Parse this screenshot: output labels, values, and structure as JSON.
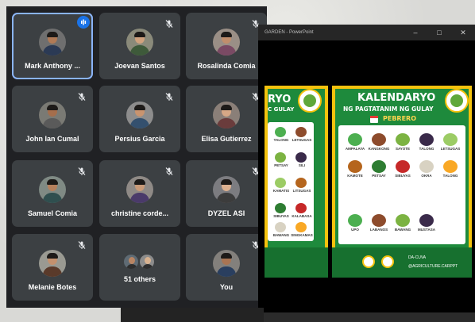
{
  "meet": {
    "tiles": [
      {
        "name": "Mark Anthony ..."
      },
      {
        "name": "Joevan Santos"
      },
      {
        "name": "Rosalinda Comia"
      },
      {
        "name": "John Ian Cumal"
      },
      {
        "name": "Persius Garcia"
      },
      {
        "name": "Elisa Gutierrez"
      },
      {
        "name": "Samuel Comia"
      },
      {
        "name": "christine corde..."
      },
      {
        "name": "DYZEL ASI"
      },
      {
        "name": "Melanie Botes"
      },
      {
        "name": "51 others"
      },
      {
        "name": "You"
      }
    ],
    "colors": {
      "speaking_border": "#8ab4f8",
      "tile_bg": "#3c4043"
    }
  },
  "ppt": {
    "window_title": "GARDEN - PowerPoint",
    "minimize": "–",
    "maximize": "□",
    "close": "✕"
  },
  "slide_left": {
    "title": "RYO",
    "subtitle": "C GULAY",
    "vegetables": [
      "TALONG",
      "LETSUGAS",
      "PETSAY",
      "SILI",
      "KAMATIS",
      "LITSUGAS",
      "SIBUYAS",
      "KALABASA",
      "BAWANG",
      "SINGKAMAS"
    ]
  },
  "slide_right": {
    "title": "KALENDARYO",
    "subtitle": "NG PAGTATANIM NG GULAY",
    "month": "PEBRERO",
    "vegetables": [
      "AMPALAYA",
      "KANGKONG",
      "SAYOTE",
      "TALONG",
      "LETSUGAS",
      "KAMOTE",
      "PETSAY",
      "SIBUYAS",
      "OKRA",
      "TALONG",
      "",
      "",
      "",
      "",
      "",
      "UPO",
      "LABANOS",
      "BAWANG",
      "MUSTASA"
    ],
    "footer_1": "DA-CUVA",
    "footer_2": "@AGRICULTURE.CARPPT"
  }
}
